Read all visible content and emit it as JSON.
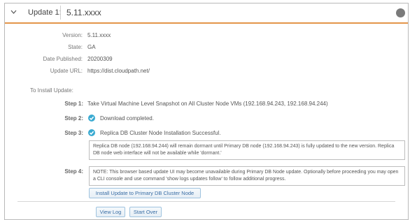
{
  "header": {
    "label": "Update 1:",
    "version": "5.11.xxxx"
  },
  "details": [
    {
      "label": "Version:",
      "value": "5.11.xxxx"
    },
    {
      "label": "State:",
      "value": "GA"
    },
    {
      "label": "Date Published:",
      "value": "20200309"
    },
    {
      "label": "Update URL:",
      "value": "https://dist.cloudpath.net/"
    }
  ],
  "install": {
    "heading": "To Install Update:",
    "step1": {
      "label": "Step 1:",
      "text": "Take Virtual Machine Level Snapshot on All Cluster Node VMs (192.168.94.243, 192.168.94.244)"
    },
    "step2": {
      "label": "Step 2:",
      "text": "Download completed."
    },
    "step3": {
      "label": "Step 3:",
      "text": "Replica DB Cluster Node Installation Successful.",
      "note": "Replica DB node (192.168.94.244) will remain dormant until Primary DB node (192.168.94.243) is fully updated to the new version. Replica DB node web interface will not be available while 'dormant.'"
    },
    "step4": {
      "label": "Step 4:",
      "note": "NOTE: This browser based update UI may become unavailable during Primary DB Node update. Optionally before proceeding you may open a CLI console and use command 'show logs updates follow' to follow additional progress.",
      "button": "Install Update to Primary DB Cluster Node"
    }
  },
  "footer": {
    "view_log": "View Log",
    "start_over": "Start Over"
  },
  "colors": {
    "accent": "#e3954a",
    "check": "#3aaad1",
    "button_text": "#3a6ea5"
  }
}
